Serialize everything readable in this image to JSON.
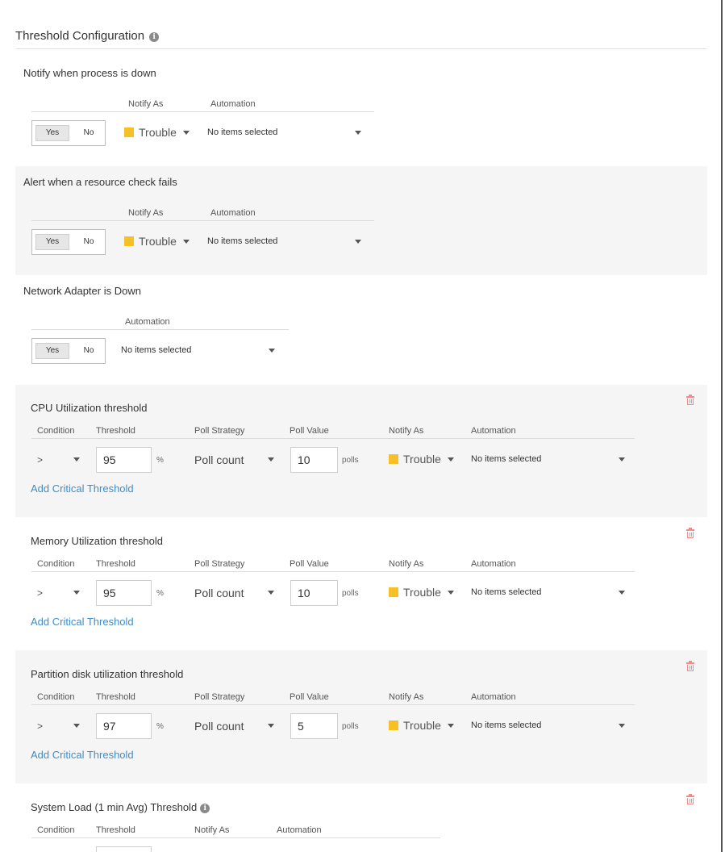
{
  "header": {
    "title": "Threshold Configuration",
    "info_icon": "info-icon"
  },
  "sections": {
    "process_down": {
      "title": "Notify when process is down",
      "col_notify": "Notify As",
      "col_automation": "Automation",
      "yes": "Yes",
      "no": "No",
      "notify_value": "Trouble",
      "notify_color": "#f6c026",
      "automation_value": "No items selected"
    },
    "resource_check": {
      "title": "Alert when a resource check fails",
      "col_notify": "Notify As",
      "col_automation": "Automation",
      "yes": "Yes",
      "no": "No",
      "notify_value": "Trouble",
      "notify_color": "#f6c026",
      "automation_value": "No items selected"
    },
    "network_adapter": {
      "title": "Network Adapter is Down",
      "col_automation": "Automation",
      "yes": "Yes",
      "no": "No",
      "automation_value": "No items selected"
    },
    "cpu": {
      "title": "CPU Utilization threshold",
      "cols": {
        "condition": "Condition",
        "threshold": "Threshold",
        "poll_strategy": "Poll Strategy",
        "poll_value": "Poll Value",
        "notify": "Notify As",
        "automation": "Automation"
      },
      "condition": ">",
      "threshold": "95",
      "unit": "%",
      "poll_strategy": "Poll count",
      "poll_value": "10",
      "poll_unit": "polls",
      "notify_value": "Trouble",
      "automation_value": "No items selected",
      "add_critical": "Add Critical Threshold"
    },
    "memory": {
      "title": "Memory Utilization threshold",
      "cols": {
        "condition": "Condition",
        "threshold": "Threshold",
        "poll_strategy": "Poll Strategy",
        "poll_value": "Poll Value",
        "notify": "Notify As",
        "automation": "Automation"
      },
      "condition": ">",
      "threshold": "95",
      "unit": "%",
      "poll_strategy": "Poll count",
      "poll_value": "10",
      "poll_unit": "polls",
      "notify_value": "Trouble",
      "automation_value": "No items selected",
      "add_critical": "Add Critical Threshold"
    },
    "partition": {
      "title": "Partition disk utilization threshold",
      "cols": {
        "condition": "Condition",
        "threshold": "Threshold",
        "poll_strategy": "Poll Strategy",
        "poll_value": "Poll Value",
        "notify": "Notify As",
        "automation": "Automation"
      },
      "condition": ">",
      "threshold": "97",
      "unit": "%",
      "poll_strategy": "Poll count",
      "poll_value": "5",
      "poll_unit": "polls",
      "notify_value": "Trouble",
      "automation_value": "No items selected",
      "add_critical": "Add Critical Threshold"
    },
    "system_load": {
      "title": "System Load (1 min Avg) Threshold",
      "cols": {
        "condition": "Condition",
        "threshold": "Threshold",
        "notify": "Notify As",
        "automation": "Automation"
      }
    }
  },
  "colors": {
    "accent_link": "#3f8dc9",
    "trouble": "#f6c026",
    "delete": "#f08c8c",
    "section_gray": "#f5f5f5"
  }
}
